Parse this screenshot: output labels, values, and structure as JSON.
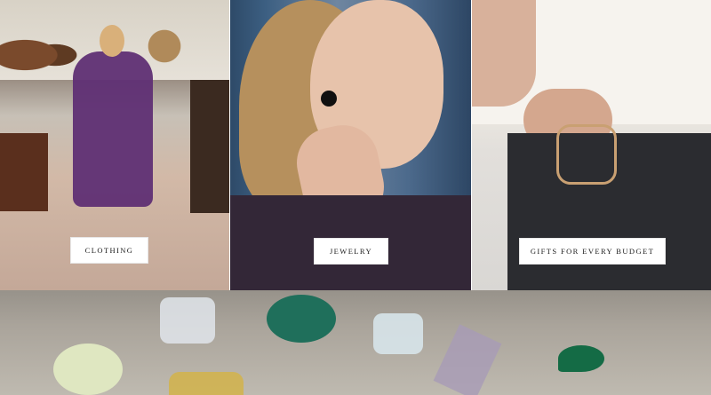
{
  "categories": [
    {
      "label": "CLOTHING"
    },
    {
      "label": "JEWELRY"
    },
    {
      "label": "GIFTS FOR EVERY BUDGET"
    }
  ]
}
